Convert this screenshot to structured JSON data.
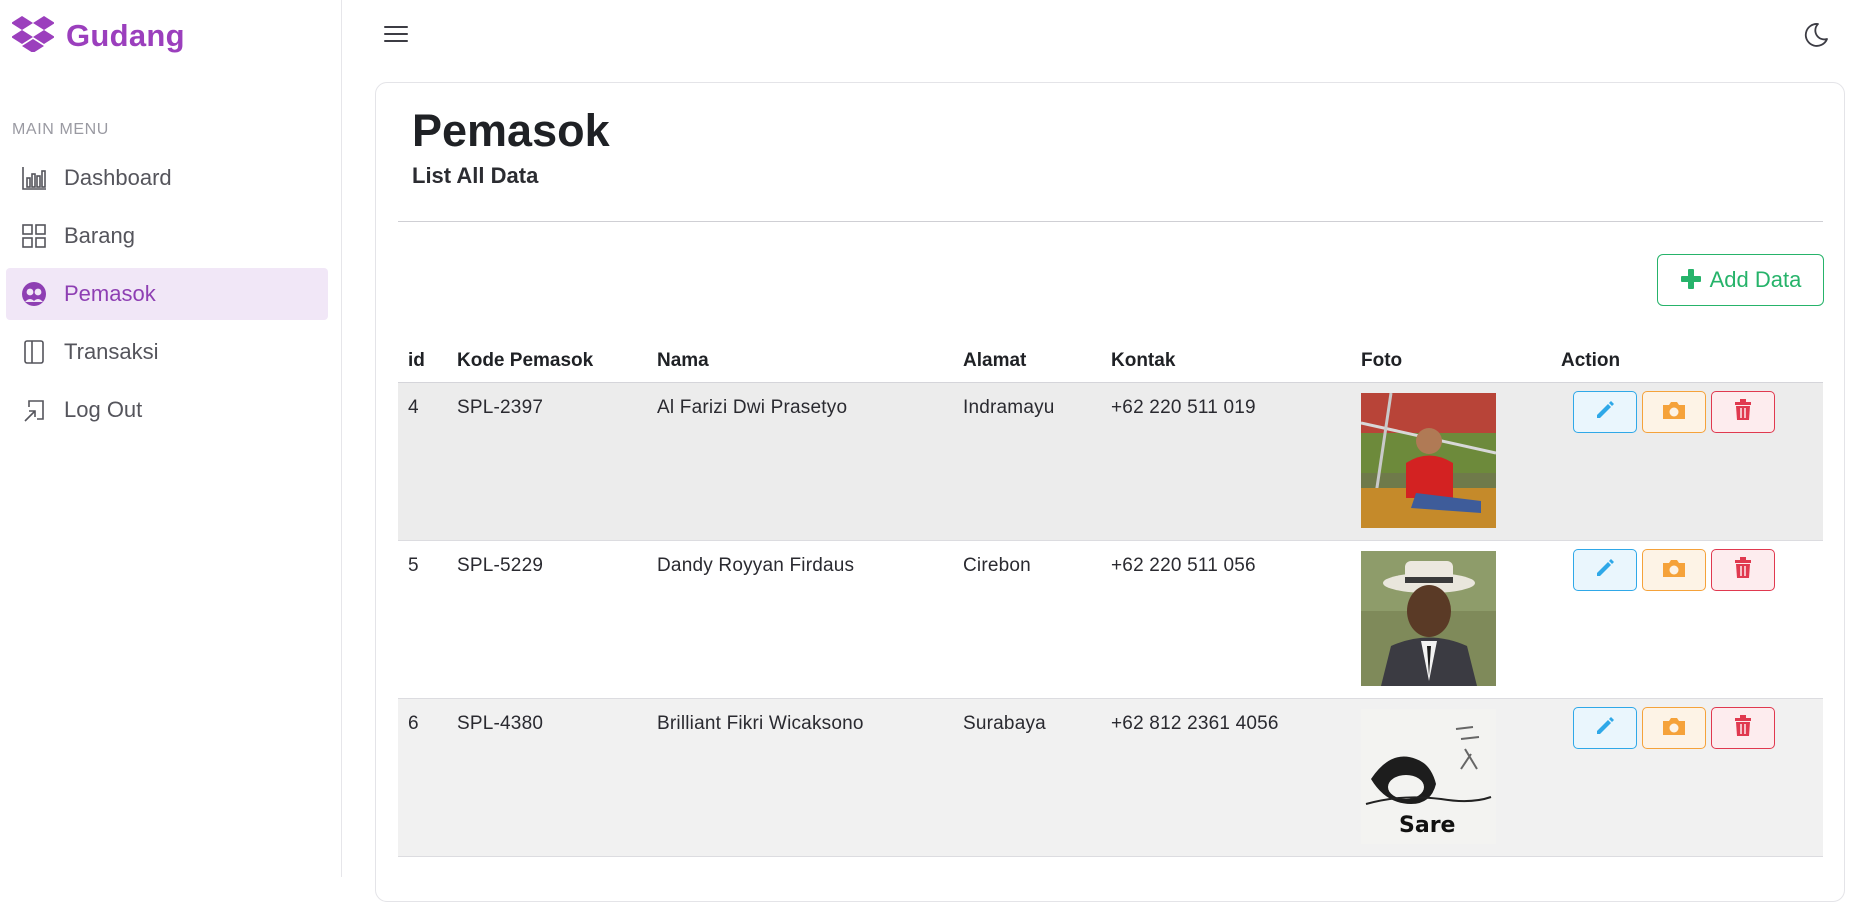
{
  "brand": {
    "name": "Gudang",
    "color": "#9b3fbd"
  },
  "sidebar": {
    "caption": "MAIN MENU",
    "items": [
      {
        "label": "Dashboard",
        "icon": "chart-bars-icon",
        "active": false
      },
      {
        "label": "Barang",
        "icon": "grid-icon",
        "active": false
      },
      {
        "label": "Pemasok",
        "icon": "people-icon",
        "active": true
      },
      {
        "label": "Transaksi",
        "icon": "book-icon",
        "active": false
      },
      {
        "label": "Log Out",
        "icon": "logout-icon",
        "active": false
      }
    ]
  },
  "topbar": {
    "menu_icon": "hamburger-icon",
    "theme_icon": "moon-icon"
  },
  "page": {
    "title": "Pemasok",
    "subtitle": "List All Data",
    "add_button": "Add Data"
  },
  "table": {
    "headers": [
      "id",
      "Kode Pemasok",
      "Nama",
      "Alamat",
      "Kontak",
      "Foto",
      "Action"
    ],
    "rows": [
      {
        "id": "4",
        "kode": "SPL-2397",
        "nama": "Al Farizi Dwi Prasetyo",
        "alamat": "Indramayu",
        "kontak": "+62 220 511 019",
        "foto": "photo-man-red-shirt"
      },
      {
        "id": "5",
        "kode": "SPL-5229",
        "nama": "Dandy Royyan Firdaus",
        "alamat": "Cirebon",
        "kontak": "+62 220 511 056",
        "foto": "photo-man-white-hat"
      },
      {
        "id": "6",
        "kode": "SPL-4380",
        "nama": "Brilliant Fikri Wicaksono",
        "alamat": "Surabaya",
        "kontak": "+62 812 2361 4056",
        "foto": "photo-sketch-sare",
        "foto_caption": "Sare"
      }
    ]
  },
  "colors": {
    "accent": "#9b3fbd",
    "success": "#26b36a",
    "info": "#2fa8e8",
    "warning": "#f5a23a",
    "danger": "#e0394f"
  }
}
